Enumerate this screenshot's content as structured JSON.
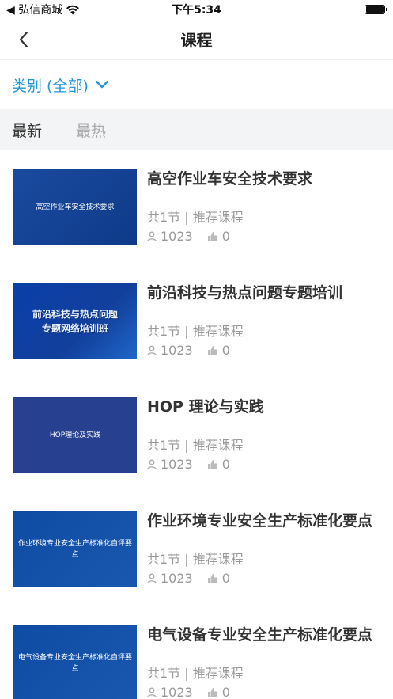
{
  "status_bar": {
    "back_app": "◀ 弘信商城",
    "time": "下午5:34"
  },
  "nav": {
    "title": "课程"
  },
  "filter": {
    "category_label": "类别 (全部)"
  },
  "sort": {
    "newest": "最新",
    "hottest": "最热"
  },
  "courses": [
    {
      "thumb_text": "高空作业车安全技术要求",
      "title": "高空作业车安全技术要求",
      "meta": "共1节 | 推荐课程",
      "views": "1023",
      "likes": "0"
    },
    {
      "thumb_line1": "前沿科技与热点问题",
      "thumb_line2": "专题网络培训班",
      "title": "前沿科技与热点问题专题培训",
      "meta": "共1节 | 推荐课程",
      "views": "1023",
      "likes": "0"
    },
    {
      "thumb_text": "HOP理论及实践",
      "title": "HOP 理论与实践",
      "meta": "共1节 | 推荐课程",
      "views": "1023",
      "likes": "0"
    },
    {
      "thumb_text": "作业环境专业安全生产标准化自评要点",
      "title": "作业环境专业安全生产标准化要点",
      "meta": "共1节 | 推荐课程",
      "views": "1023",
      "likes": "0"
    },
    {
      "thumb_text": "电气设备专业安全生产标准化自评要点",
      "title": "电气设备专业安全生产标准化要点",
      "meta": "共1节 | 推荐课程",
      "views": "1023",
      "likes": "0"
    }
  ],
  "colors": {
    "accent": "#2196d8",
    "sort_bg": "#f3f4f6"
  }
}
